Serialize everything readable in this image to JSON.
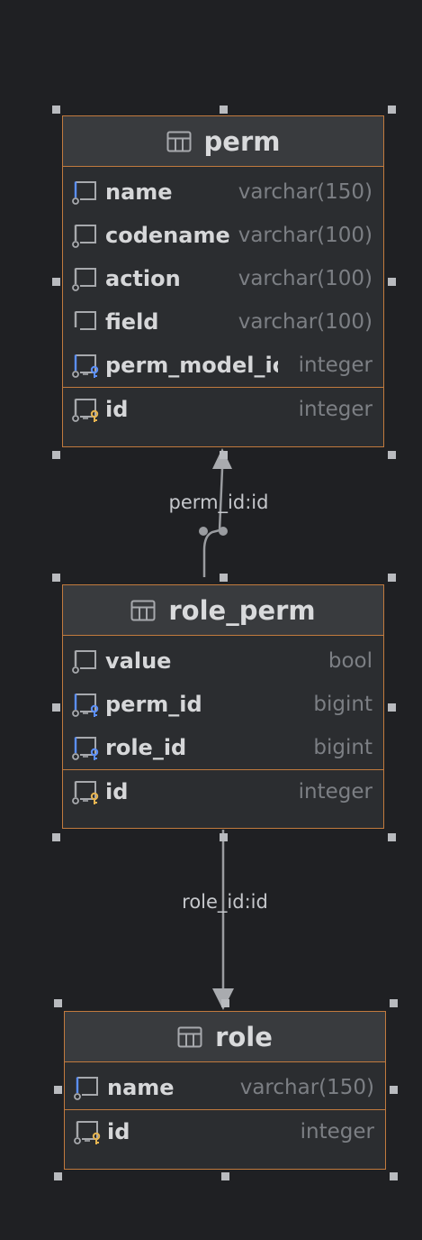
{
  "tables": {
    "perm": {
      "name": "perm",
      "fields": [
        {
          "name": "name",
          "type": "varchar(150)",
          "icon": "index-column-icon"
        },
        {
          "name": "codename",
          "type": "varchar(100)",
          "icon": "column-icon"
        },
        {
          "name": "action",
          "type": "varchar(100)",
          "icon": "column-icon"
        },
        {
          "name": "field",
          "type": "varchar(100)",
          "icon": "plain-column-icon"
        },
        {
          "name": "perm_model_ic",
          "type": "integer",
          "icon": "foreign-key-column-icon"
        }
      ],
      "pk": {
        "name": "id",
        "type": "integer",
        "icon": "primary-key-column-icon"
      }
    },
    "role_perm": {
      "name": "role_perm",
      "fields": [
        {
          "name": "value",
          "type": "bool",
          "icon": "column-icon"
        },
        {
          "name": "perm_id",
          "type": "bigint",
          "icon": "foreign-key-column-icon"
        },
        {
          "name": "role_id",
          "type": "bigint",
          "icon": "foreign-key-column-icon"
        }
      ],
      "pk": {
        "name": "id",
        "type": "integer",
        "icon": "primary-key-column-icon"
      }
    },
    "role": {
      "name": "role",
      "fields": [
        {
          "name": "name",
          "type": "varchar(150)",
          "icon": "index-column-icon"
        }
      ],
      "pk": {
        "name": "id",
        "type": "integer",
        "icon": "primary-key-column-icon"
      }
    }
  },
  "relations": [
    {
      "from": "role_perm",
      "to": "perm",
      "label": "perm_id:id"
    },
    {
      "from": "role_perm",
      "to": "role",
      "label": "role_id:id"
    }
  ],
  "colors": {
    "background": "#1f2023",
    "table_border": "#c17a3e",
    "foreign_key": "#5b8ff9",
    "primary_key": "#e6b450",
    "connector": "#9a9ca0"
  }
}
